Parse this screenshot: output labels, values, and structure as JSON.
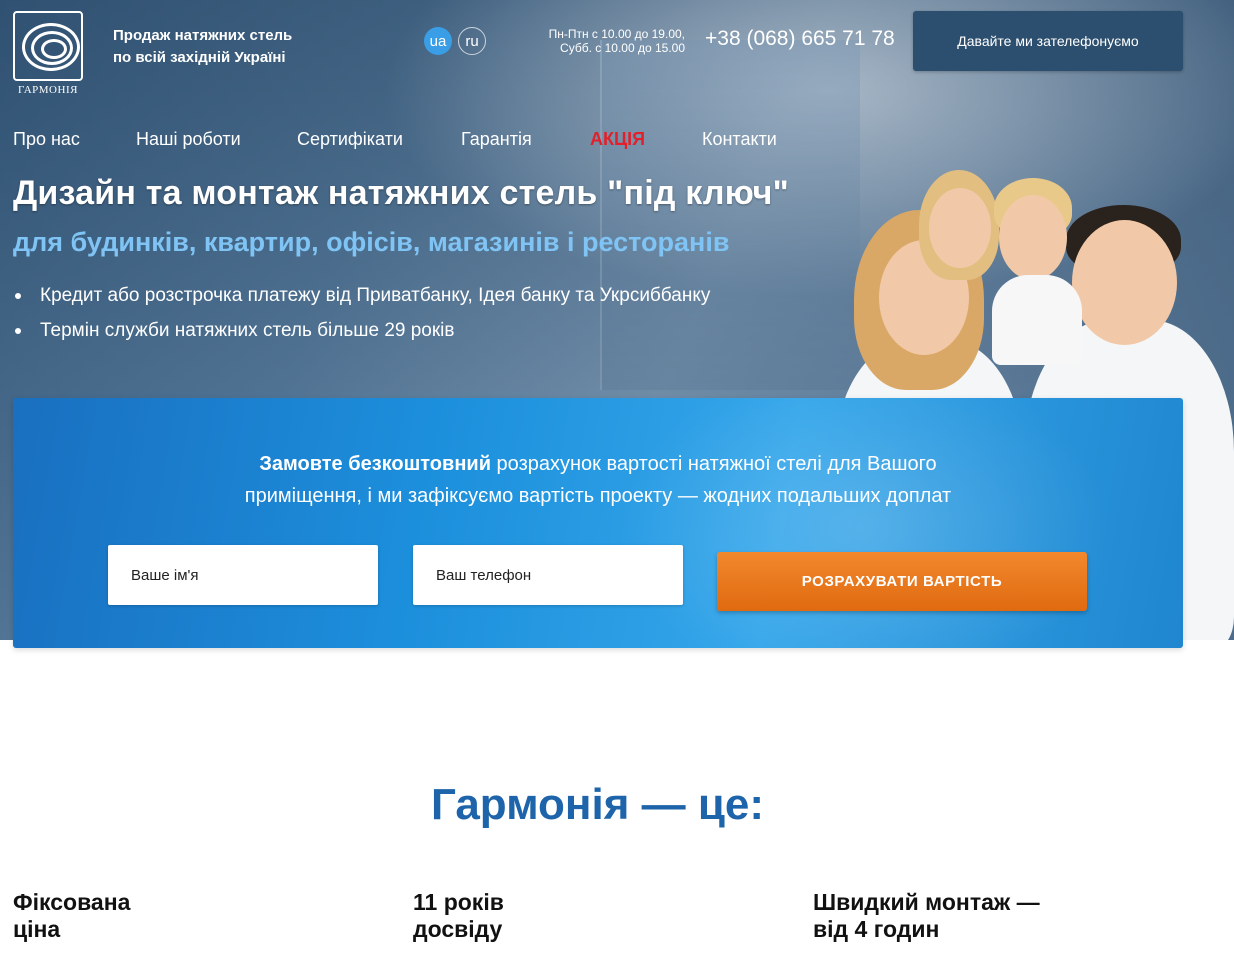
{
  "header": {
    "logo_text": "ГАРМОНІЯ",
    "tagline": [
      "Продаж натяжних стель",
      "по всій західній Україні"
    ],
    "languages": [
      "ua",
      "ru"
    ],
    "hours": [
      "Пн-Птн с 10.00 до 19.00,",
      "Субб. с 10.00 до 15.00"
    ],
    "phone": "+38 (068) 665 71 78",
    "callback_label": "Давайте ми зателефонуємо"
  },
  "nav": {
    "items": [
      {
        "label": "Про нас"
      },
      {
        "label": "Наші роботи"
      },
      {
        "label": "Сертифікати"
      },
      {
        "label": "Гарантія"
      },
      {
        "label": "АКЦІЯ"
      },
      {
        "label": "Контакти"
      }
    ]
  },
  "hero": {
    "title": "Дизайн та монтаж натяжних стель \"під ключ\"",
    "subtitle": "для будинків, квартир, офісів, магазинів і ресторанів",
    "bullets": [
      "Кредит або розстрочка платежу від Приватбанку, Ідея банку та Укрсиббанку",
      "Термін служби натяжних стель більше 29 років"
    ]
  },
  "form": {
    "text_bold": "Замовте безкоштовний",
    "text_rest_1": " розрахунок вартості натяжної стелі для Вашого",
    "text_line_2": "приміщення, і ми зафіксуємо вартість проекту — жодних подальших доплат",
    "name_placeholder": "Ваше ім'я",
    "phone_placeholder": "Ваш телефон",
    "submit_label": "РОЗРАХУВАТИ ВАРТІСТЬ"
  },
  "benefits": {
    "title": "Гармонія — це:",
    "items": [
      {
        "lines": [
          "Фіксована",
          "ціна"
        ]
      },
      {
        "lines": [
          "11 років",
          "досвіду"
        ]
      },
      {
        "lines": [
          "Швидкий монтаж —",
          "від 4 годин"
        ]
      }
    ]
  },
  "colors": {
    "accent_blue": "#1e64aa",
    "promo_red": "#e3202a",
    "cta_orange": "#e9761c",
    "panel_blue": "#1c8fdc"
  }
}
